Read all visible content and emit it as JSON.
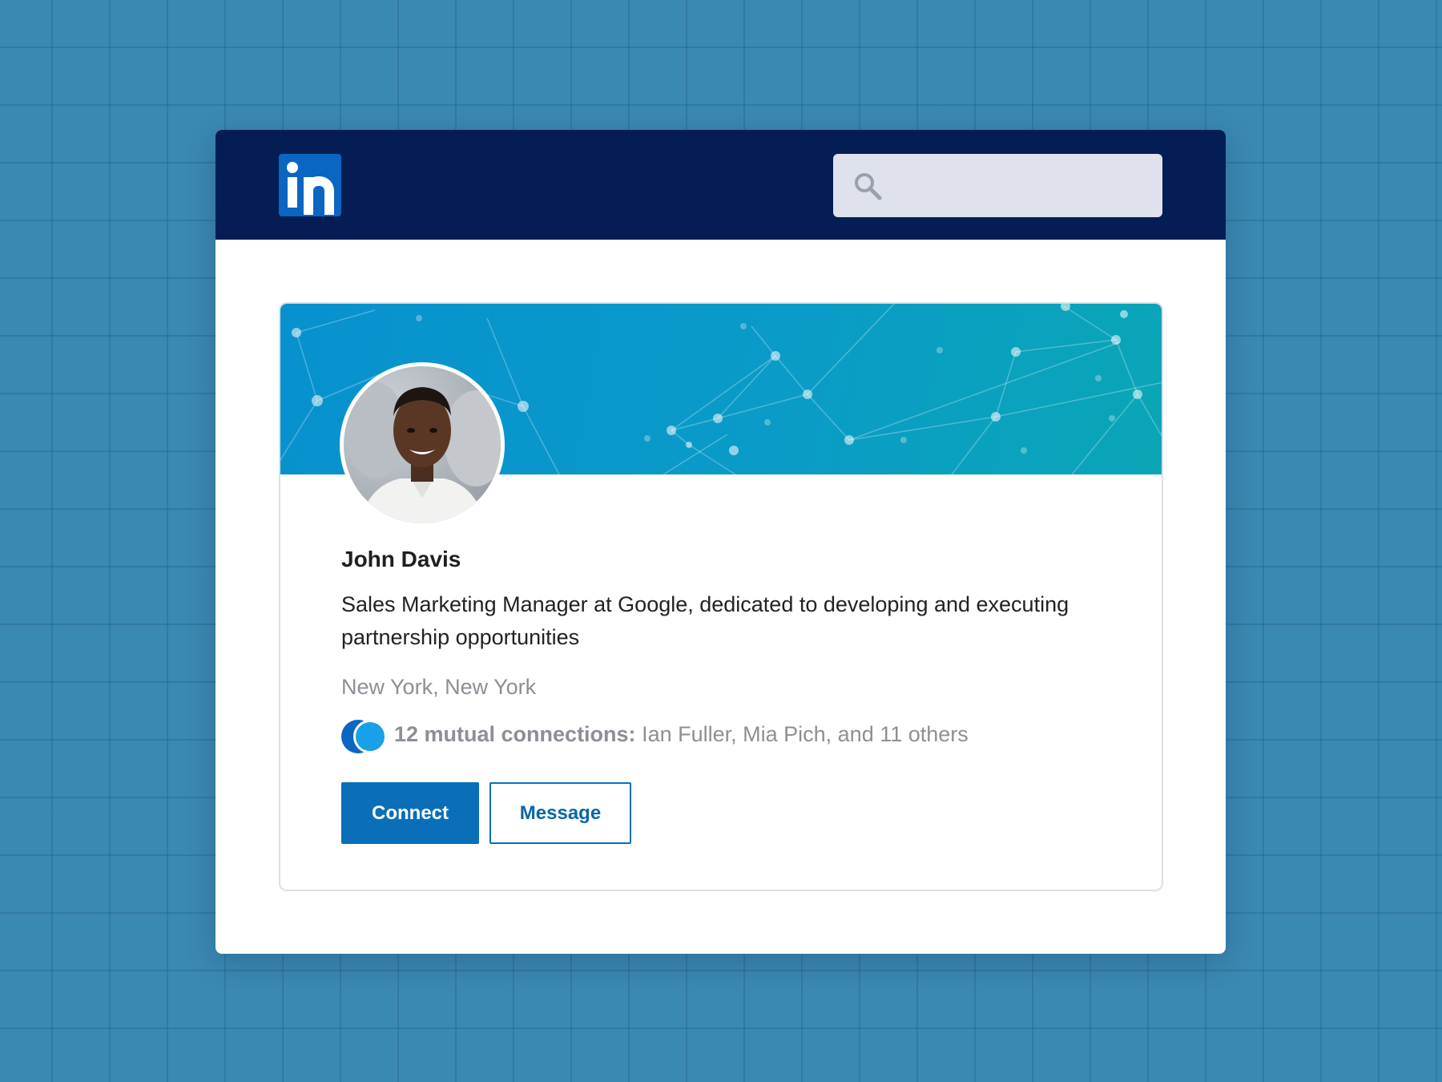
{
  "brand": {
    "logo_text": "in",
    "color": "#0a66c2",
    "header_bg": "#051d55"
  },
  "search": {
    "placeholder": "",
    "value": "",
    "icon": "search-icon"
  },
  "profile": {
    "name": "John Davis",
    "headline": "Sales Marketing Manager at Google, dedicated to developing and executing partnership opportunities",
    "location": "New York, New York",
    "mutual": {
      "count_label": "12 mutual connections:",
      "names": " Ian Fuller, Mia Pich, and 11 others"
    },
    "avatar": "profile-photo"
  },
  "actions": {
    "connect_label": "Connect",
    "message_label": "Message"
  },
  "colors": {
    "accent": "#0a6fb8",
    "muted_text": "#8c8f95",
    "banner_start": "#0791cf",
    "banner_end": "#0aa6b6"
  }
}
